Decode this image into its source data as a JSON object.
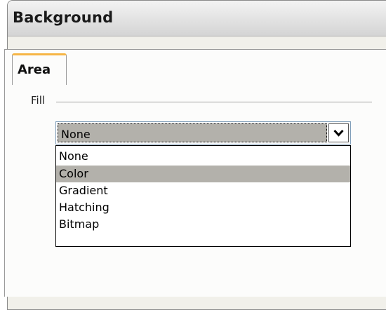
{
  "dialog": {
    "title": "Background"
  },
  "tabs": [
    {
      "label": "Area",
      "active": true
    }
  ],
  "fill": {
    "label": "Fill",
    "selected_value": "None",
    "options": [
      {
        "label": "None",
        "highlighted": false
      },
      {
        "label": "Color",
        "highlighted": true
      },
      {
        "label": "Gradient",
        "highlighted": false
      },
      {
        "label": "Hatching",
        "highlighted": false
      },
      {
        "label": "Bitmap",
        "highlighted": false
      }
    ]
  },
  "colors": {
    "tab_accent": "#f6b545",
    "highlight": "#b3b1ab"
  },
  "icons": {
    "dropdown_button": "chevron-down-icon"
  }
}
